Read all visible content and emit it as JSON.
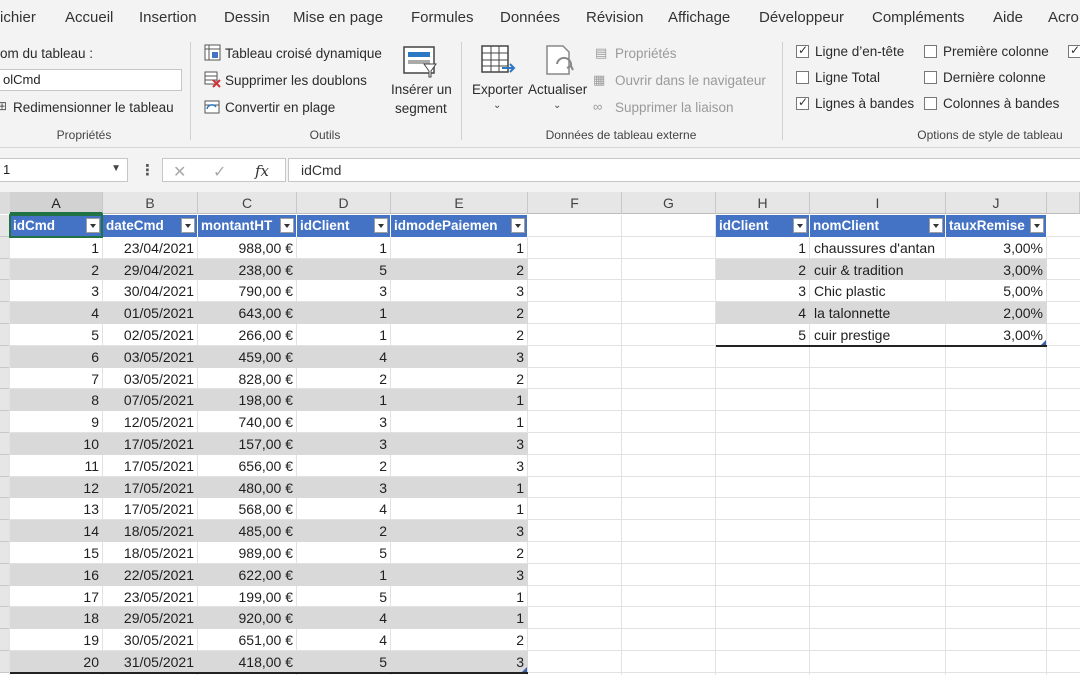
{
  "menu": [
    "ichier",
    "Accueil",
    "Insertion",
    "Dessin",
    "Mise en page",
    "Formules",
    "Données",
    "Révision",
    "Affichage",
    "Développeur",
    "Compléments",
    "Aide",
    "Acro"
  ],
  "ribbon": {
    "proprietes": {
      "name_label": "om du tableau :",
      "name_value": "olCmd",
      "resize_label": "Redimensionner le tableau",
      "group_label": "Propriétés"
    },
    "outils": {
      "pivot": "Tableau croisé dynamique",
      "dedupe": "Supprimer les doublons",
      "convert": "Convertir en plage",
      "segment_line1": "Insérer un",
      "segment_line2": "segment",
      "group_label": "Outils"
    },
    "donnees_externes": {
      "export": "Exporter",
      "refresh": "Actualiser",
      "properties": "Propriétés",
      "open_browser": "Ouvrir dans le navigateur",
      "unlink": "Supprimer la liaison",
      "group_label": "Données de tableau externe"
    },
    "options_style": {
      "header_row": "Ligne d’en-tête",
      "total_row": "Ligne Total",
      "banded_rows": "Lignes à bandes",
      "first_col": "Première colonne",
      "last_col": "Dernière colonne",
      "banded_cols": "Colonnes à bandes",
      "header_row_checked": true,
      "total_row_checked": false,
      "banded_rows_checked": true,
      "first_col_checked": false,
      "last_col_checked": false,
      "banded_cols_checked": false,
      "group_label": "Options de style de tableau"
    }
  },
  "formula_bar": {
    "name_box": "1",
    "content": "idCmd",
    "fx": "fx"
  },
  "columns": [
    "A",
    "B",
    "C",
    "D",
    "E",
    "F",
    "G",
    "H",
    "I",
    "J"
  ],
  "table_cmd": {
    "headers": [
      "idCmd",
      "dateCmd",
      "montantHT",
      "idClient",
      "idmodePaiemen"
    ],
    "rows": [
      [
        "1",
        "23/04/2021",
        "988,00 €",
        "1",
        "1"
      ],
      [
        "2",
        "29/04/2021",
        "238,00 €",
        "5",
        "2"
      ],
      [
        "3",
        "30/04/2021",
        "790,00 €",
        "3",
        "3"
      ],
      [
        "4",
        "01/05/2021",
        "643,00 €",
        "1",
        "2"
      ],
      [
        "5",
        "02/05/2021",
        "266,00 €",
        "1",
        "2"
      ],
      [
        "6",
        "03/05/2021",
        "459,00 €",
        "4",
        "3"
      ],
      [
        "7",
        "03/05/2021",
        "828,00 €",
        "2",
        "2"
      ],
      [
        "8",
        "07/05/2021",
        "198,00 €",
        "1",
        "1"
      ],
      [
        "9",
        "12/05/2021",
        "740,00 €",
        "3",
        "1"
      ],
      [
        "10",
        "17/05/2021",
        "157,00 €",
        "3",
        "3"
      ],
      [
        "11",
        "17/05/2021",
        "656,00 €",
        "2",
        "3"
      ],
      [
        "12",
        "17/05/2021",
        "480,00 €",
        "3",
        "1"
      ],
      [
        "13",
        "17/05/2021",
        "568,00 €",
        "4",
        "1"
      ],
      [
        "14",
        "18/05/2021",
        "485,00 €",
        "2",
        "3"
      ],
      [
        "15",
        "18/05/2021",
        "989,00 €",
        "5",
        "2"
      ],
      [
        "16",
        "22/05/2021",
        "622,00 €",
        "1",
        "3"
      ],
      [
        "17",
        "23/05/2021",
        "199,00 €",
        "5",
        "1"
      ],
      [
        "18",
        "29/05/2021",
        "920,00 €",
        "4",
        "1"
      ],
      [
        "19",
        "30/05/2021",
        "651,00 €",
        "4",
        "2"
      ],
      [
        "20",
        "31/05/2021",
        "418,00 €",
        "5",
        "3"
      ]
    ]
  },
  "table_client": {
    "headers": [
      "idClient",
      "nomClient",
      "tauxRemise"
    ],
    "rows": [
      [
        "1",
        "chaussures d'antan",
        "3,00%"
      ],
      [
        "2",
        "cuir & tradition",
        "3,00%"
      ],
      [
        "3",
        "Chic plastic",
        "5,00%"
      ],
      [
        "4",
        "la talonnette",
        "2,00%"
      ],
      [
        "5",
        "cuir prestige",
        "3,00%"
      ]
    ]
  },
  "colors": {
    "table_header": "#4472c4",
    "band": "#d9d9d9",
    "active_border": "#217346"
  }
}
